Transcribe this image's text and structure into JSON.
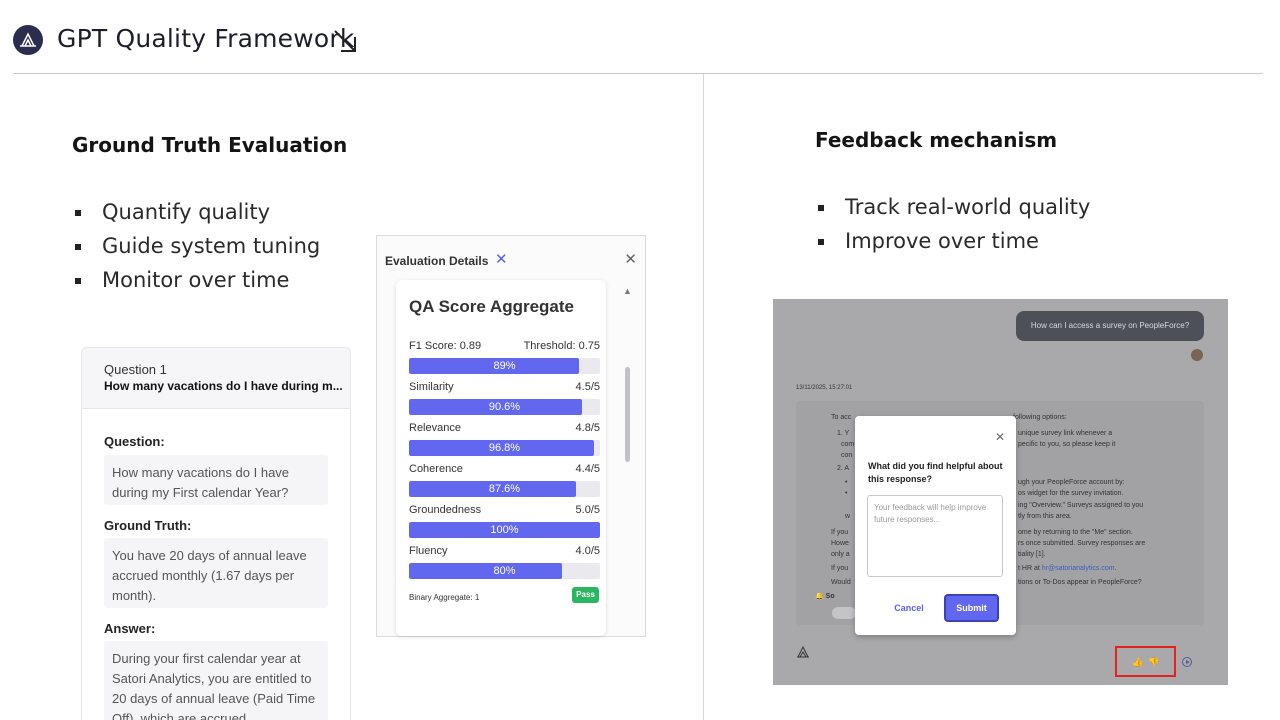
{
  "header": {
    "title": "GPT Quality Framework"
  },
  "left": {
    "section_title": "Ground Truth Evaluation",
    "bullets": [
      "Quantify quality",
      "Guide system tuning",
      "Monitor over time"
    ],
    "question_card": {
      "number": "Question 1",
      "title": "How many vacations do I have during m...",
      "question_label": "Question:",
      "question": "How many vacations do I have during my First calendar Year?",
      "ground_truth_label": "Ground Truth:",
      "ground_truth": "You have 20 days of annual leave accrued monthly (1.67 days per month).",
      "answer_label": "Answer:",
      "answer": "During your first calendar year at Satori Analytics, you are entitled to 20 days of annual leave (Paid Time Off), which are accrued"
    },
    "eval_panel": {
      "title": "Evaluation Details",
      "card_title": "QA Score Aggregate",
      "f1_label": "F1 Score: 0.89",
      "threshold_label": "Threshold: 0.75",
      "metrics": [
        {
          "name": "",
          "score": "",
          "pct_label": "89%",
          "fill": 0.89
        },
        {
          "name": "Similarity",
          "score": "4.5/5",
          "pct_label": "90.6%",
          "fill": 0.906
        },
        {
          "name": "Relevance",
          "score": "4.8/5",
          "pct_label": "96.8%",
          "fill": 0.968
        },
        {
          "name": "Coherence",
          "score": "4.4/5",
          "pct_label": "87.6%",
          "fill": 0.876
        },
        {
          "name": "Groundedness",
          "score": "5.0/5",
          "pct_label": "100%",
          "fill": 1.0
        },
        {
          "name": "Fluency",
          "score": "4.0/5",
          "pct_label": "80%",
          "fill": 0.8
        }
      ],
      "binary_label": "Binary Aggregate: 1",
      "pass_label": "Pass"
    }
  },
  "right": {
    "section_title": "Feedback mechanism",
    "bullets": [
      "Track real-world quality",
      "Improve over time"
    ],
    "chat": {
      "user_message": "How can I access a survey on PeopleForce?",
      "timestamp": "13/11/2025, 15:27:01",
      "answer_lines": {
        "l1a": "To acc",
        "l1b": "following options:",
        "l2a": "1. Y",
        "l2b": "unique survey link whenever a",
        "l3a": "com",
        "l3b": "pecific to you, so please keep it",
        "l4a": "con",
        "l5a": "2. A",
        "l5b": "ugh your PeopleForce account by:",
        "l6a": "•",
        "l6b": "os widget for the survey invitation.",
        "l7a": "•",
        "l7b": "ing \"Overview.\" Surveys assigned to you",
        "l8a": "w",
        "l8b": "tly from this area.",
        "l9a": "If you",
        "l9b": "ome by returning to the \"Me\" section.",
        "l10a": "Howe",
        "l10b": "rs once submitted. Survey responses are",
        "l11a": "only a",
        "l11b": "tiality [1].",
        "l12a": "If you",
        "l12b": "t HR at",
        "l12link": "hr@satorianalytics.com",
        "l12c": ".",
        "l13a": "Would",
        "l13b": "tions or To-Dos appear in PeopleForce?",
        "l14a": "So"
      },
      "modal": {
        "question": "What did you find helpful about this response?",
        "placeholder": "Your feedback will help improve future responses...",
        "cancel": "Cancel",
        "submit": "Submit"
      }
    }
  },
  "colors": {
    "accent": "#6167ef",
    "pass": "#2bb662",
    "highlight": "#e52222",
    "logo_bg": "#2c2d4e"
  }
}
